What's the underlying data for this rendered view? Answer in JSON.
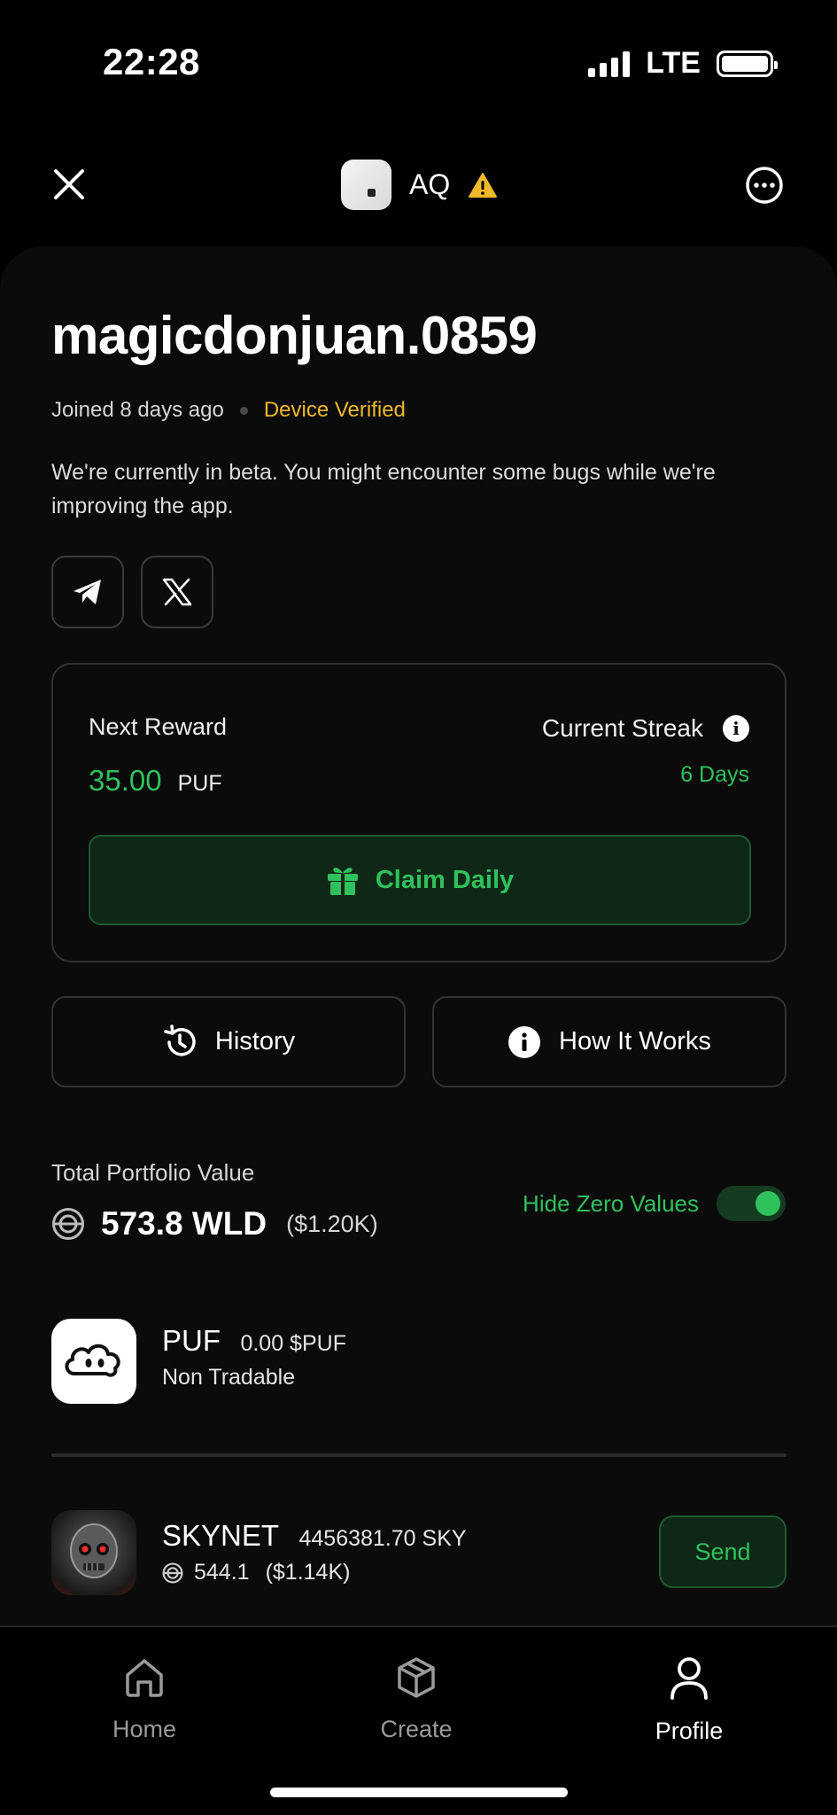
{
  "status_bar": {
    "time": "22:28",
    "network": "LTE"
  },
  "header": {
    "title": "AQ"
  },
  "profile": {
    "username": "magicdonjuan.0859",
    "joined": "Joined 8 days ago",
    "verified": "Device Verified",
    "beta_notice": "We're currently in beta. You might encounter some bugs while we're improving the app."
  },
  "reward": {
    "next_label": "Next Reward",
    "amount": "35.00",
    "unit": "PUF",
    "streak_label": "Current Streak",
    "streak_value": "6 Days",
    "claim_label": "Claim Daily"
  },
  "actions": {
    "history": "History",
    "how_it_works": "How It Works"
  },
  "portfolio": {
    "label": "Total Portfolio Value",
    "value": "573.8 WLD",
    "usd": "($1.20K)",
    "hide_zero_label": "Hide Zero Values",
    "hide_zero_on": true
  },
  "tokens": [
    {
      "name": "PUF",
      "balance": "0.00 $PUF",
      "sub": "Non Tradable"
    },
    {
      "name": "SKYNET",
      "balance": "4456381.70 SKY",
      "wld": "544.1",
      "usd": "($1.14K)",
      "action": "Send"
    }
  ],
  "tabs": [
    {
      "label": "Home",
      "icon": "home-icon"
    },
    {
      "label": "Create",
      "icon": "box-icon"
    },
    {
      "label": "Profile",
      "icon": "user-icon",
      "active": true
    }
  ],
  "colors": {
    "accent_green": "#2fc15c",
    "warning_yellow": "#f0b929",
    "background": "#000000"
  }
}
